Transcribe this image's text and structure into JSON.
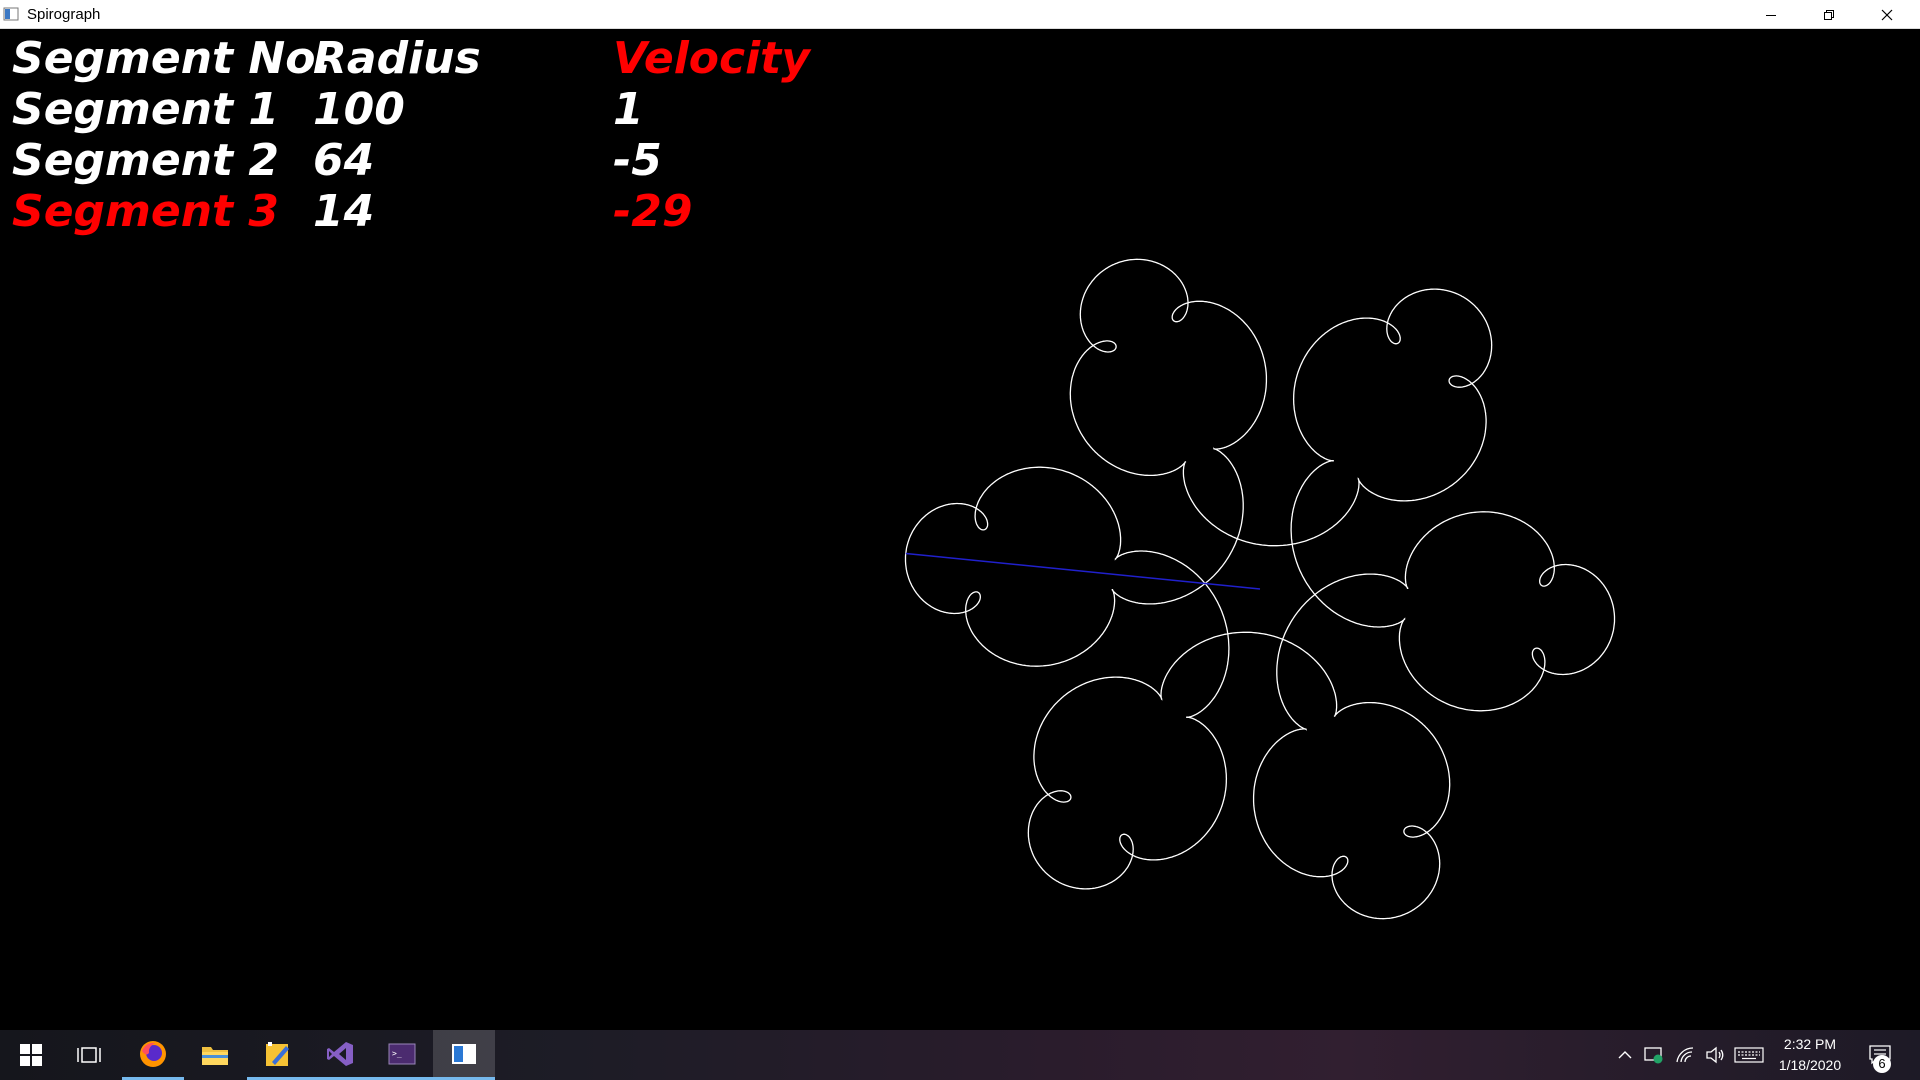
{
  "window": {
    "title": "Spirograph",
    "minimize_icon": "minimize-icon",
    "maximize_icon": "restore-icon",
    "close_icon": "close-icon"
  },
  "hud": {
    "headers": {
      "segment": "Segment No.",
      "radius": "Radius",
      "velocity": "Velocity"
    },
    "rows": [
      {
        "segment": "Segment 1",
        "radius": "100",
        "velocity": "1",
        "selected": false
      },
      {
        "segment": "Segment 2",
        "radius": "64",
        "velocity": "-5",
        "selected": false
      },
      {
        "segment": "Segment 3",
        "radius": "14",
        "velocity": "-29",
        "selected": true
      }
    ],
    "colors": {
      "normal": "#ffffff",
      "highlight": "#ff0000",
      "arm": "#2020cc",
      "trace": "#ffffff"
    }
  },
  "taskbar": {
    "apps": [
      {
        "name": "firefox",
        "icon": "firefox-icon"
      },
      {
        "name": "file-explorer",
        "icon": "folder-icon"
      },
      {
        "name": "editor",
        "icon": "pen-icon"
      },
      {
        "name": "visual-studio",
        "icon": "visual-studio-icon"
      },
      {
        "name": "terminal",
        "icon": "terminal-icon"
      },
      {
        "name": "spirograph",
        "icon": "window-icon"
      }
    ],
    "clock": {
      "time": "2:32 PM",
      "date": "1/18/2020"
    },
    "notifications": "6"
  }
}
